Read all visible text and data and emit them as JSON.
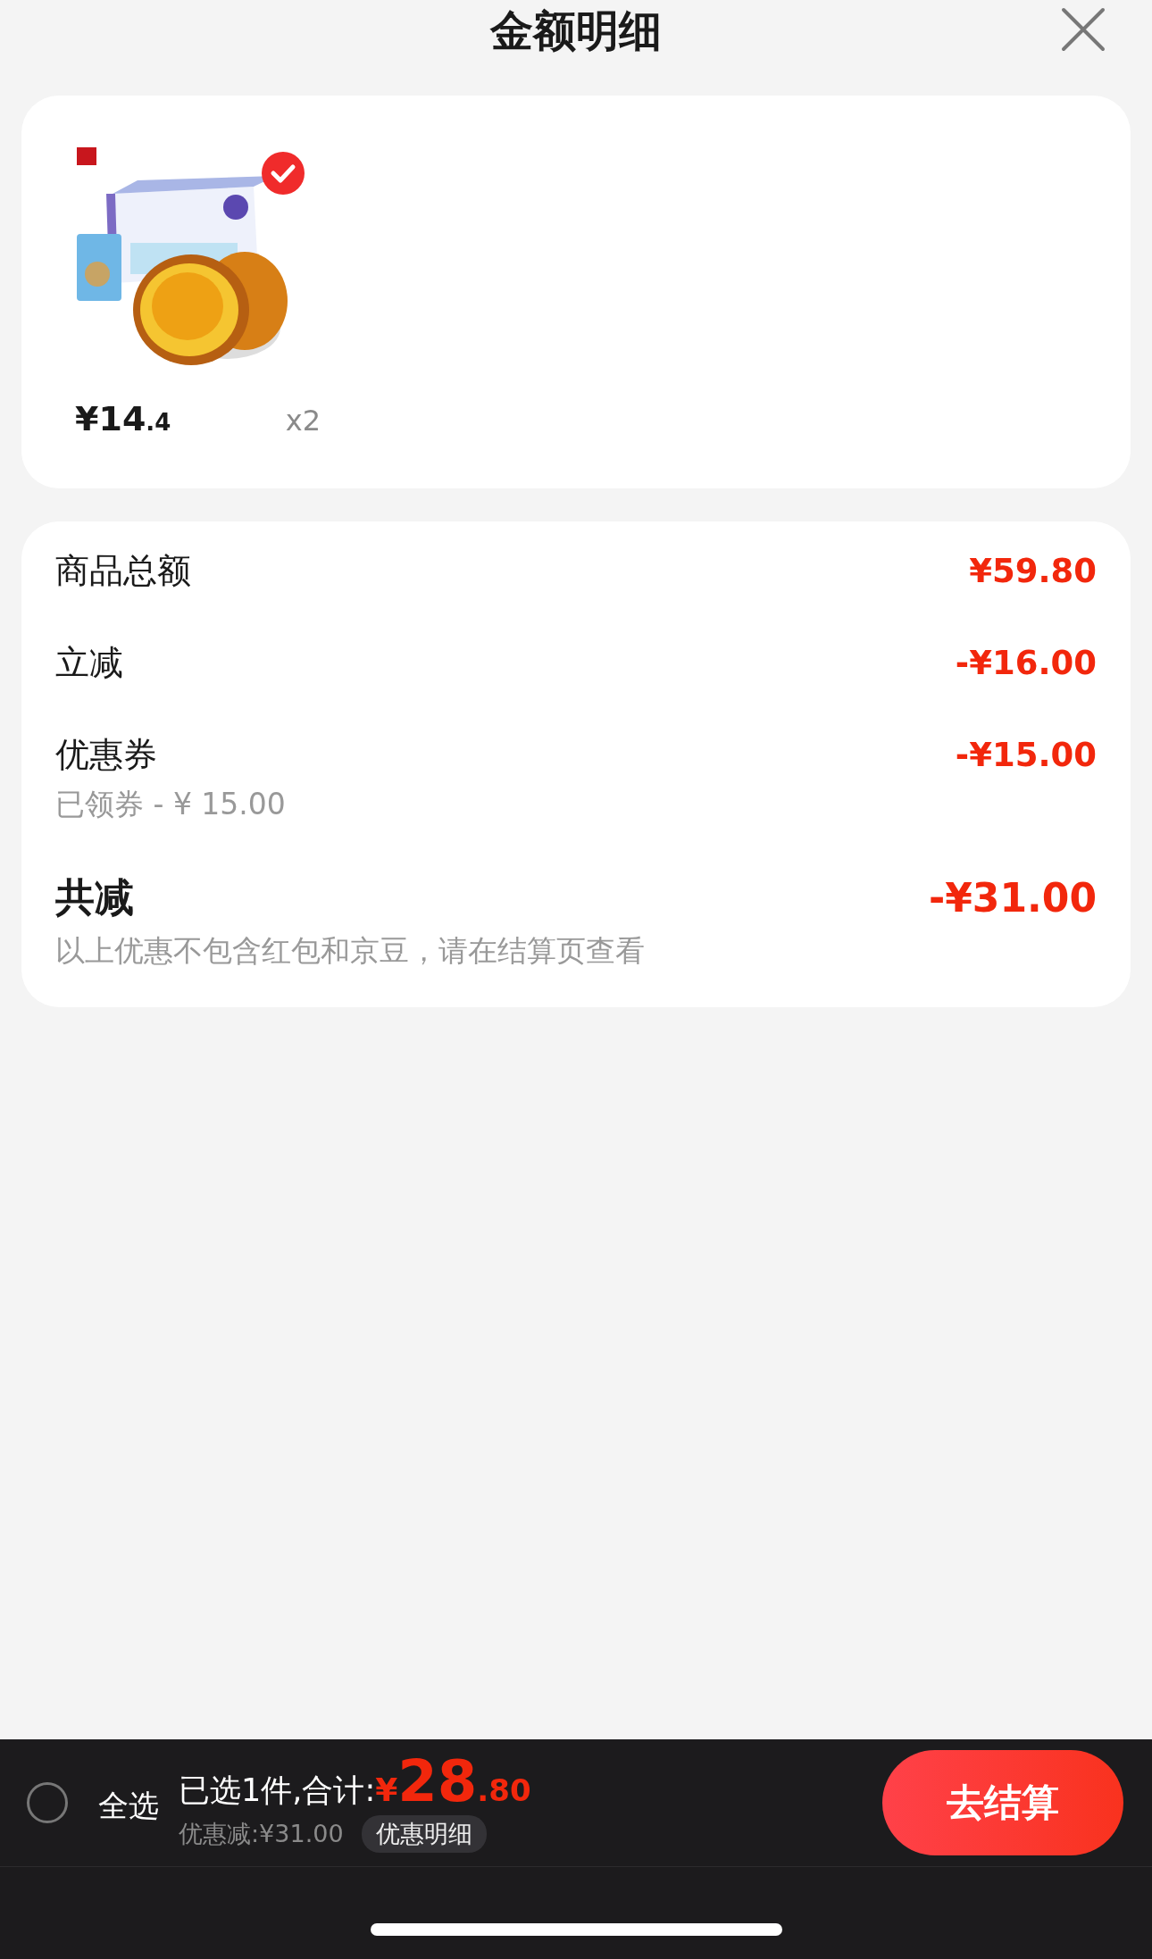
{
  "header": {
    "title": "金额明细"
  },
  "product": {
    "selected": true,
    "price_main": "¥14",
    "price_decimal": ".4",
    "quantity": "x2"
  },
  "summary": {
    "rows": [
      {
        "kind": "line",
        "label": "商品总额",
        "amount": "¥59.80"
      },
      {
        "kind": "line",
        "label": "立减",
        "amount": "-¥16.00"
      },
      {
        "kind": "line",
        "label": "优惠券",
        "amount": "-¥15.00",
        "note": "已领券 - ¥ 15.00"
      },
      {
        "kind": "total",
        "label": "共减",
        "amount": "-¥31.00",
        "note": "以上优惠不包含红包和京豆，请在结算页查看"
      }
    ]
  },
  "bottom_bar": {
    "select_all": {
      "label": "全选",
      "checked": false
    },
    "selected_text": "已选1件,合计:",
    "total_currency": "¥",
    "total_main": "28",
    "total_decimal": ".80",
    "discount": "优惠减:¥31.00",
    "details_button": "优惠明细",
    "checkout_button": "去结算"
  }
}
